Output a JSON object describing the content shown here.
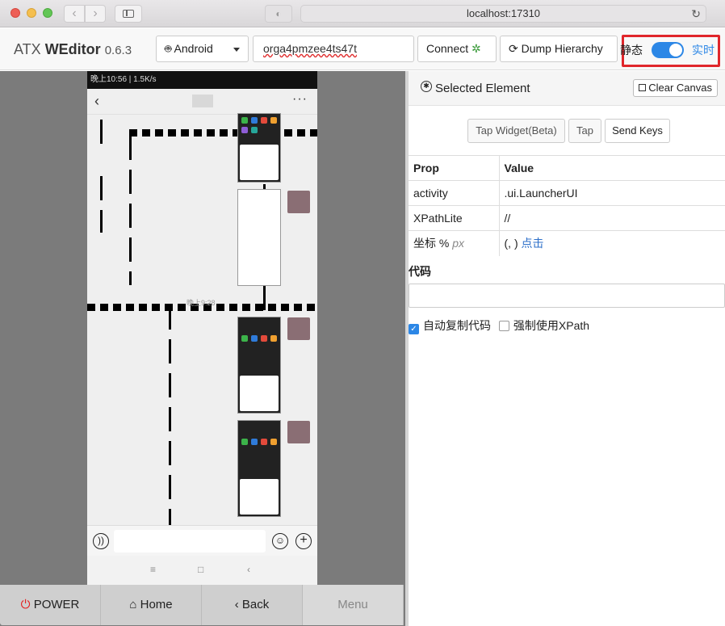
{
  "browser": {
    "url": "localhost:17310"
  },
  "header": {
    "brand_prefix": "ATX",
    "brand_name": "WEditor",
    "version": "0.6.3",
    "platform": "Android",
    "serial": "orga4pmzee4ts47t",
    "connect_label": "Connect",
    "dump_label": "Dump Hierarchy",
    "static_label": "静态",
    "live_label": "实时",
    "live_enabled": true
  },
  "phone": {
    "status_time": "晚上10:56 | 1.5K/s",
    "timestamp": "晚上9:28"
  },
  "bottom": {
    "power": "POWER",
    "home": "Home",
    "back": "Back",
    "menu": "Menu"
  },
  "panel": {
    "title": "Selected Element",
    "clear": "Clear Canvas",
    "tap_widget": "Tap Widget(Beta)",
    "tap": "Tap",
    "send_keys": "Send Keys",
    "col_prop": "Prop",
    "col_value": "Value",
    "rows": [
      {
        "prop": "activity",
        "value": ".ui.LauncherUI"
      },
      {
        "prop": "XPathLite",
        "value": "//"
      },
      {
        "prop": "坐标 %",
        "unit": "px",
        "value": "(, )",
        "link": "点击"
      }
    ],
    "code_label": "代码",
    "auto_copy": "自动复制代码",
    "force_xpath": "强制使用XPath"
  },
  "colors": {
    "accent": "#2c87e6",
    "highlight": "#e0262b",
    "power": "#e32424"
  }
}
